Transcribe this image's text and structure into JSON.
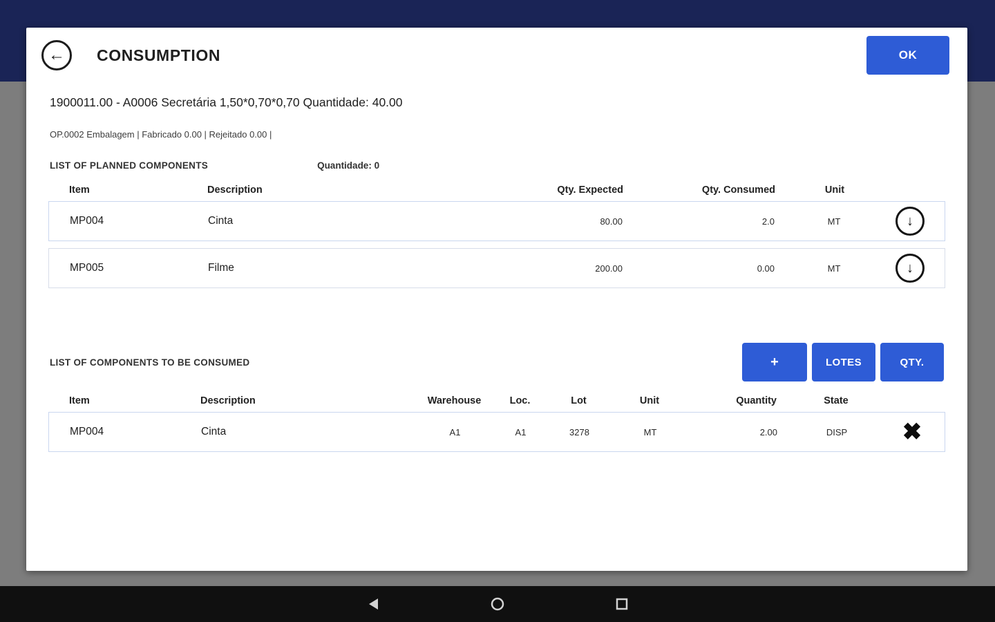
{
  "header": {
    "title": "CONSUMPTION",
    "ok_label": "OK"
  },
  "order": {
    "line1": "1900011.00 - A0006 Secretária 1,50*0,70*0,70 Quantidade: 40.00",
    "line2": "OP.0002 Embalagem | Fabricado 0.00 | Rejeitado 0.00 |"
  },
  "planned": {
    "section_title": "LIST OF PLANNED COMPONENTS",
    "quantidade_label": "Quantidade: 0",
    "headers": [
      "Item",
      "Description",
      "Qty. Expected",
      "Qty. Consumed",
      "Unit"
    ],
    "rows": [
      {
        "item": "MP004",
        "description": "Cinta",
        "qty_expected": "80.00",
        "qty_consumed": "2.0",
        "unit": "MT"
      },
      {
        "item": "MP005",
        "description": "Filme",
        "qty_expected": "200.00",
        "qty_consumed": "0.00",
        "unit": "MT"
      }
    ]
  },
  "consume": {
    "section_title": "LIST OF COMPONENTS TO BE CONSUMED",
    "buttons": {
      "add": "+",
      "lotes": "LOTES",
      "qty": "QTY."
    },
    "headers": [
      "Item",
      "Description",
      "Warehouse",
      "Loc.",
      "Lot",
      "Unit",
      "Quantity",
      "State"
    ],
    "rows": [
      {
        "item": "MP004",
        "description": "Cinta",
        "warehouse": "A1",
        "loc": "A1",
        "lot": "3278",
        "unit": "MT",
        "quantity": "2.00",
        "state": "DISP"
      }
    ]
  },
  "icons": {
    "back_arrow": "←",
    "download_arrow": "↓",
    "close_x": "✖"
  },
  "colors": {
    "accent_blue": "#2e5cd6",
    "topbar_navy": "#1a2456",
    "backdrop_gray": "#7d7d7d",
    "navbar_black": "#101010",
    "row_border": "#c9d6ef"
  }
}
